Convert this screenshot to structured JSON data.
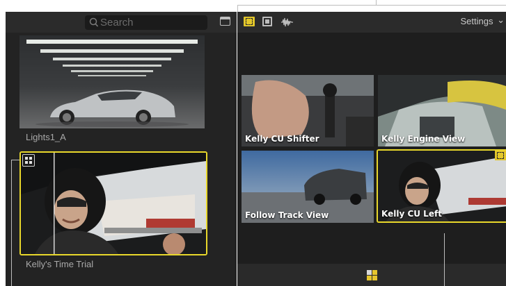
{
  "browser": {
    "search_placeholder": "Search",
    "clips": [
      {
        "name": "Lights1_A",
        "selected": false
      },
      {
        "name": "Kelly's Time Trial",
        "selected": true,
        "badge": "multicam-icon"
      }
    ]
  },
  "viewer": {
    "settings_label": "Settings",
    "settings_chevron": "⌄",
    "toolbar_icons": [
      "video-audio-angle-icon",
      "video-angle-icon",
      "audio-angle-icon"
    ],
    "angles": [
      {
        "name": "Kelly CU Shifter",
        "active": false
      },
      {
        "name": "Kelly Engine View",
        "active": false
      },
      {
        "name": "Follow Track View",
        "active": false
      },
      {
        "name": "Kelly CU Left",
        "active": true
      }
    ],
    "footer_icon": "angle-grid-icon"
  },
  "colors": {
    "selection": "#e9d82b",
    "panel": "#232323",
    "header": "#2b2b2b"
  }
}
